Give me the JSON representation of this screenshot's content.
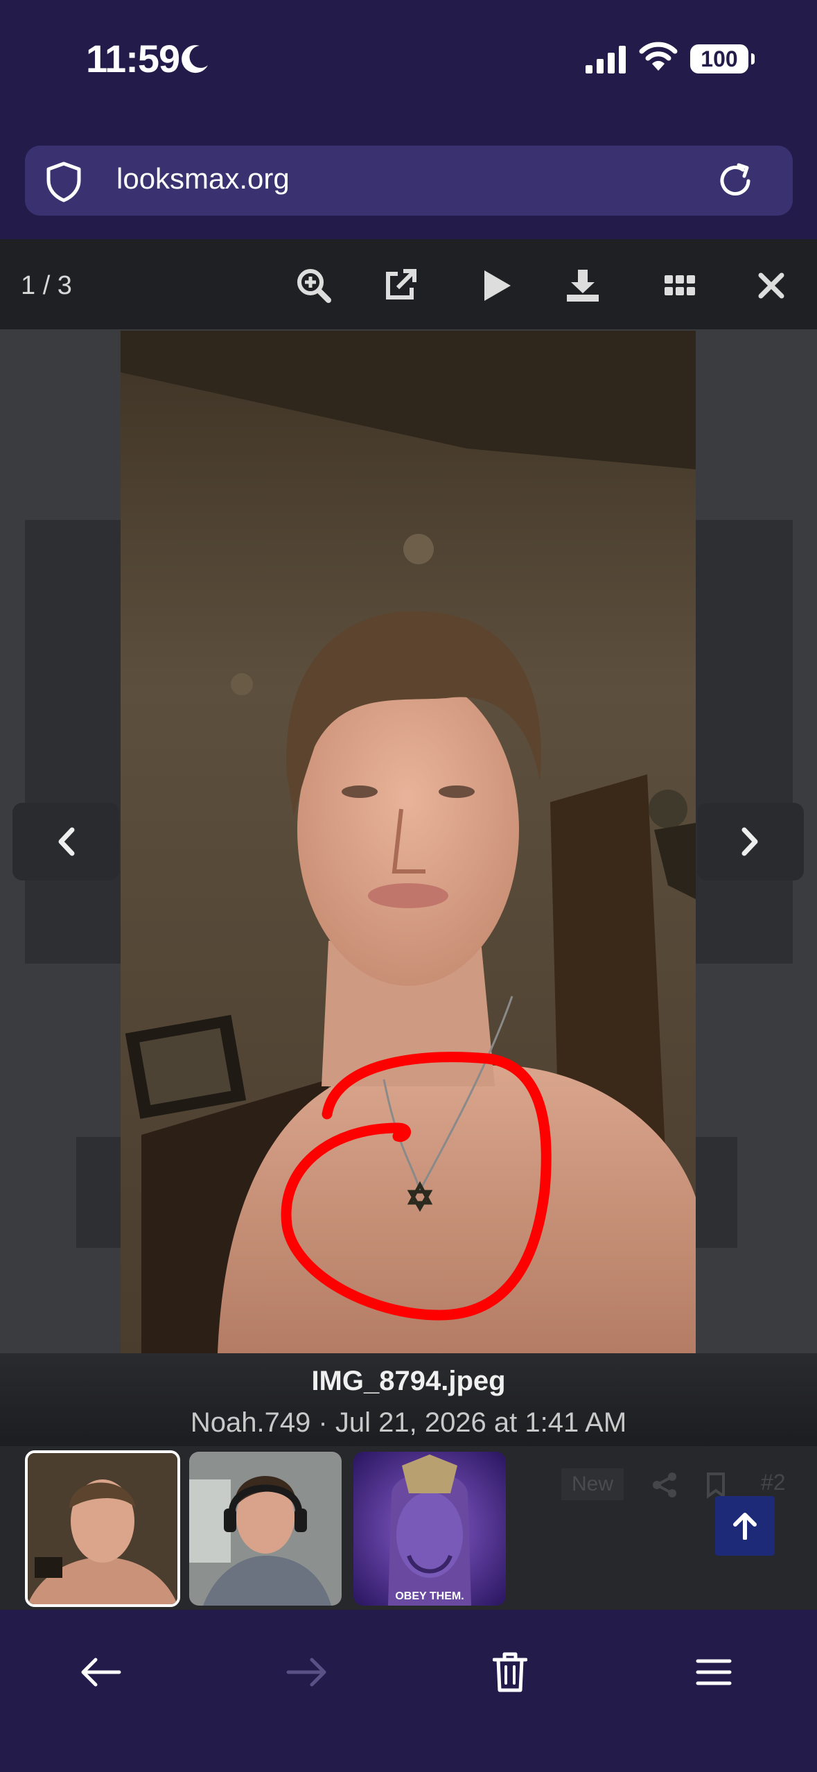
{
  "status_bar": {
    "time": "11:59",
    "battery": "100"
  },
  "browser": {
    "url": "looksmax.org"
  },
  "viewer": {
    "counter": "1 / 3",
    "filename": "IMG_8794.jpeg",
    "meta": "Noah.749 · Jul 21, 2026 at 1:41 AM",
    "thumbnails": [
      {
        "caption": ""
      },
      {
        "caption": ""
      },
      {
        "caption": "OBEY THEM."
      }
    ]
  },
  "background_page": {
    "new_label": "New",
    "post_number": "#2"
  },
  "colors": {
    "browser_chrome": "#231b4a",
    "url_bar": "#3a3270",
    "viewer_toolbar": "#1f2023",
    "annotation_circle": "#ff0000",
    "scroll_top_button": "#1c2a78"
  },
  "icons": {
    "toolbar": [
      "zoom-in-icon",
      "open-external-icon",
      "play-icon",
      "download-icon",
      "grid-icon",
      "close-icon"
    ],
    "bottom_nav": [
      "back-arrow-icon",
      "forward-arrow-icon",
      "trash-icon",
      "menu-icon"
    ]
  }
}
